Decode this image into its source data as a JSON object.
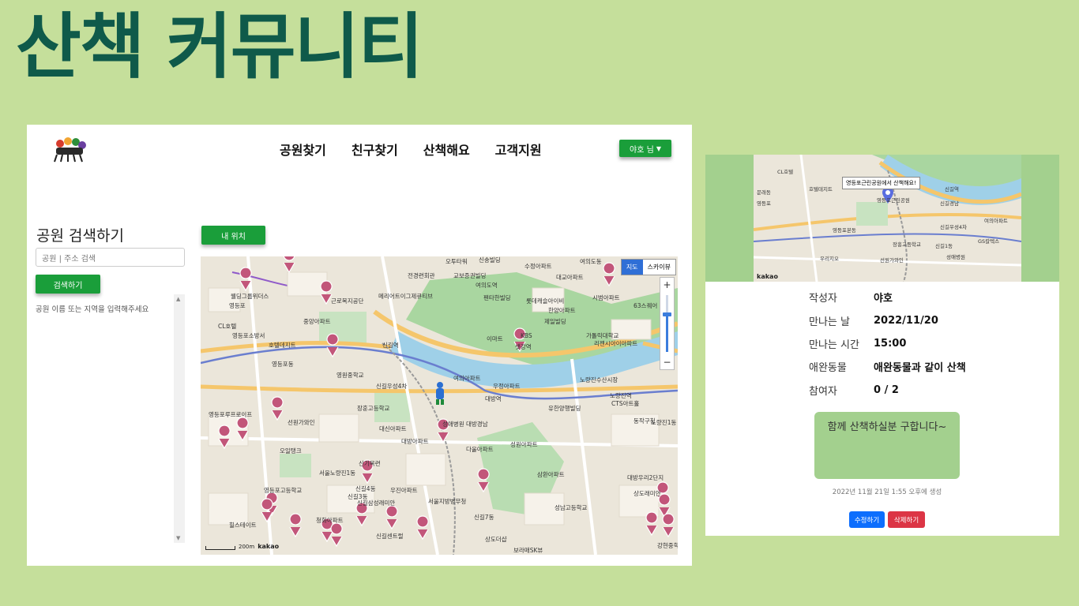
{
  "slide_title": "산책 커뮤니티",
  "nav": {
    "items": [
      "공원찾기",
      "친구찾기",
      "산책해요",
      "고객지원"
    ],
    "user_label": "야호 님"
  },
  "search": {
    "title": "공원 검색하기",
    "placeholder": "공원 | 주소 검색",
    "button": "검색하기",
    "hint": "공원 이름 또는 지역을 입력해주세요"
  },
  "map": {
    "my_location_button": "내 위치",
    "map_type_map": "지도",
    "map_type_skyview": "스카이뷰",
    "scale_label": "200m",
    "kakao_label": "kakao",
    "labels": [
      "오투타워",
      "신송빌딩",
      "여의도동",
      "전경련회관",
      "교보증권빌딩",
      "대교아파트",
      "수정아파트",
      "여의도역",
      "시범아파트",
      "웰딩그룹위더스",
      "영등포",
      "근로복지공단",
      "메리어트이그제큐티브",
      "펜타한빌딩",
      "롯데캐슬아이비",
      "한양아파트",
      "중앙아파트",
      "제일빌딩",
      "KBS",
      "63스퀘어",
      "CL호텔",
      "영등포소방서",
      "호텔데지트",
      "이마트",
      "샛강역",
      "가톨릭대학교",
      "리젠시아이아파트",
      "신길역",
      "영등포동",
      "영원중학교",
      "여의아파트",
      "우정아파트",
      "대방역",
      "노량진역",
      "노량진수산시장",
      "CTS아트홀",
      "동작구청",
      "신길우성4차",
      "장훈고등학교",
      "선원가와인",
      "대신아파트",
      "성애병원",
      "대방경남",
      "유한양행빌딩",
      "노량진1동",
      "영등포루프로이프",
      "오일탱크",
      "신기목련",
      "다울아파트",
      "성원아파트",
      "대방우리2단지",
      "서울노량진1동",
      "신길4동",
      "우진아파트",
      "삼환아파트",
      "영등포고등학교",
      "신길3동",
      "신길삼성래미안",
      "서울지방병무청",
      "신길7동",
      "성남고등학교",
      "상도래미안",
      "청화아파트",
      "힐스테이트",
      "신길센트럴",
      "보라매SK뷰",
      "강현중학교",
      "상도더샵",
      "대방아파트"
    ]
  },
  "thumb_map": {
    "bubble": "영등포근린공원에서 산책해요!",
    "kakao_label": "kakao",
    "labels": [
      "CL호텔",
      "문래동",
      "영등포",
      "호텔데지트",
      "신길역",
      "신길경남",
      "영등포본동",
      "여의아파트",
      "신길우성4차",
      "장흥고등학교",
      "선원가와인",
      "GS칼텍스",
      "성애병원",
      "우리지오",
      "신길1동",
      "영등포근린공원"
    ]
  },
  "post": {
    "rows": [
      {
        "key": "작성자",
        "value": "야호"
      },
      {
        "key": "만나는 날",
        "value": "2022/11/20"
      },
      {
        "key": "만나는 시간",
        "value": "15:00"
      },
      {
        "key": "애완동물",
        "value": "애완동물과 같이 산책"
      },
      {
        "key": "참여자",
        "value": "0 / 2"
      }
    ],
    "message": "함께 산책하실분 구합니다~",
    "created": "2022년 11월 21일 1:55 오후에 생성",
    "edit_button": "수정하기",
    "delete_button": "삭제하기"
  },
  "colors": {
    "background": "#c5df9b",
    "title": "#0f5a4a",
    "accent_green": "#1a9e3a",
    "card_green": "#a3d08e",
    "edit_blue": "#0d6efd",
    "delete_red": "#dc3545",
    "marker": "#c2567a"
  }
}
